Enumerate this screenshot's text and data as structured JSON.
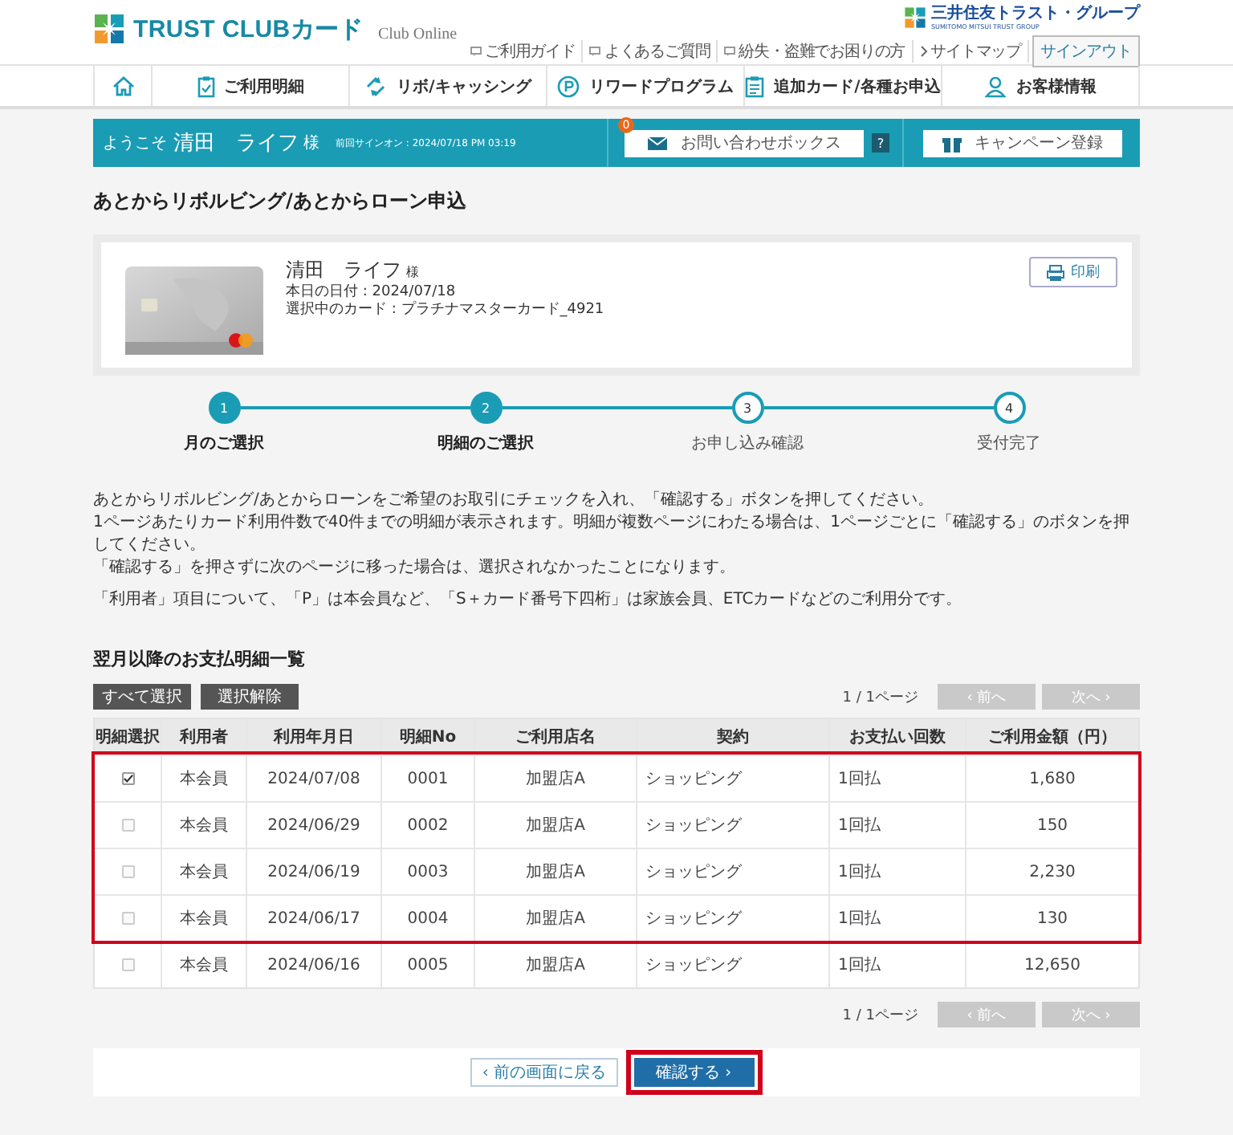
{
  "header": {
    "logo_text": "TRUST CLUBカード",
    "logo_sub": "Club Online",
    "group_name": "三井住友トラスト・グループ",
    "group_sub": "SUMITOMO MITSUI TRUST GROUP",
    "links": [
      {
        "label": "ご利用ガイド",
        "kind": "bubble"
      },
      {
        "label": "よくあるご質問",
        "kind": "bubble"
      },
      {
        "label": "紛失・盗難でお困りの方",
        "kind": "bubble"
      },
      {
        "label": "サイトマップ",
        "kind": "arrow"
      }
    ],
    "signout": "サインアウト"
  },
  "nav": [
    {
      "kind": "home"
    },
    {
      "kind": "statement",
      "label": "ご利用明細"
    },
    {
      "kind": "revolving",
      "label": "リボ/キャッシング"
    },
    {
      "kind": "points",
      "label": "リワードプログラム"
    },
    {
      "kind": "form",
      "label": "追加カード/各種お申込"
    },
    {
      "kind": "person",
      "label": "お客様情報"
    }
  ],
  "welcome": {
    "greeting": "ようこそ",
    "name": "清田　ライフ",
    "honorific": "様",
    "last_signin": "前回サインオン : 2024/07/18 PM 03:19",
    "inbox_label": "お問い合わせボックス",
    "inbox_count": "0",
    "help": "?",
    "campaign": "キャンペーン登録"
  },
  "page_title": "あとからリボルビング/あとからローン申込",
  "card_panel": {
    "name": "清田　ライフ",
    "honorific": "様",
    "date": "本日の日付 : 2024/07/18",
    "card": "選択中のカード : プラチナマスターカード_4921",
    "print": "印刷"
  },
  "steps": [
    {
      "number": "1",
      "label": "月のご選択",
      "completed": true
    },
    {
      "number": "2",
      "label": "明細のご選択",
      "completed": true
    },
    {
      "number": "3",
      "label": "お申し込み確認",
      "completed": false
    },
    {
      "number": "4",
      "label": "受付完了",
      "completed": false
    }
  ],
  "notes": [
    "あとからリボルビング/あとからローンをご希望のお取引にチェックを入れ、「確認する」ボタンを押してください。",
    "1ページあたりカード利用件数で40件までの明細が表示されます。明細が複数ページにわたる場合は、1ページごとに「確認する」のボタンを押してください。",
    "「確認する」を押さずに次のページに移った場合は、選択されなかったことになります。",
    "「利用者」項目について、「P」は本会員など、「S＋カード番号下四桁」は家族会員、ETCカードなどのご利用分です。"
  ],
  "list": {
    "title": "翌月以降のお支払明細一覧",
    "select_all": "すべて選択",
    "clear": "選択解除",
    "pagination_top": {
      "page_info": "1 / 1ページ",
      "prev": "‹ 前へ",
      "next": "次へ ›",
      "disabled": true
    },
    "columns": [
      "明細選択",
      "利用者",
      "利用年月日",
      "明細No",
      "ご利用店名",
      "契約",
      "お支払い回数",
      "ご利用金額（円）"
    ],
    "rows": [
      {
        "checked": true,
        "highlighted": true,
        "cells": [
          "",
          "本会員",
          "2024/07/08",
          "0001",
          "加盟店A",
          "ショッピング",
          "1回払",
          "1,680"
        ]
      },
      {
        "checked": false,
        "highlighted": true,
        "cells": [
          "",
          "本会員",
          "2024/06/29",
          "0002",
          "加盟店A",
          "ショッピング",
          "1回払",
          "150"
        ]
      },
      {
        "checked": false,
        "highlighted": true,
        "cells": [
          "",
          "本会員",
          "2024/06/19",
          "0003",
          "加盟店A",
          "ショッピング",
          "1回払",
          "2,230"
        ]
      },
      {
        "checked": false,
        "highlighted": true,
        "cells": [
          "",
          "本会員",
          "2024/06/17",
          "0004",
          "加盟店A",
          "ショッピング",
          "1回払",
          "130"
        ]
      },
      {
        "checked": false,
        "highlighted": false,
        "cells": [
          "",
          "本会員",
          "2024/06/16",
          "0005",
          "加盟店A",
          "ショッピング",
          "1回払",
          "12,650"
        ]
      }
    ],
    "pagination_bottom": {
      "page_info": "1 / 1ページ",
      "prev": "‹ 前へ",
      "next": "次へ ›",
      "disabled": true
    }
  },
  "actions": {
    "back": "‹ 前の画面に戻る",
    "confirm": "確認する ›",
    "confirm_highlighted": true
  }
}
